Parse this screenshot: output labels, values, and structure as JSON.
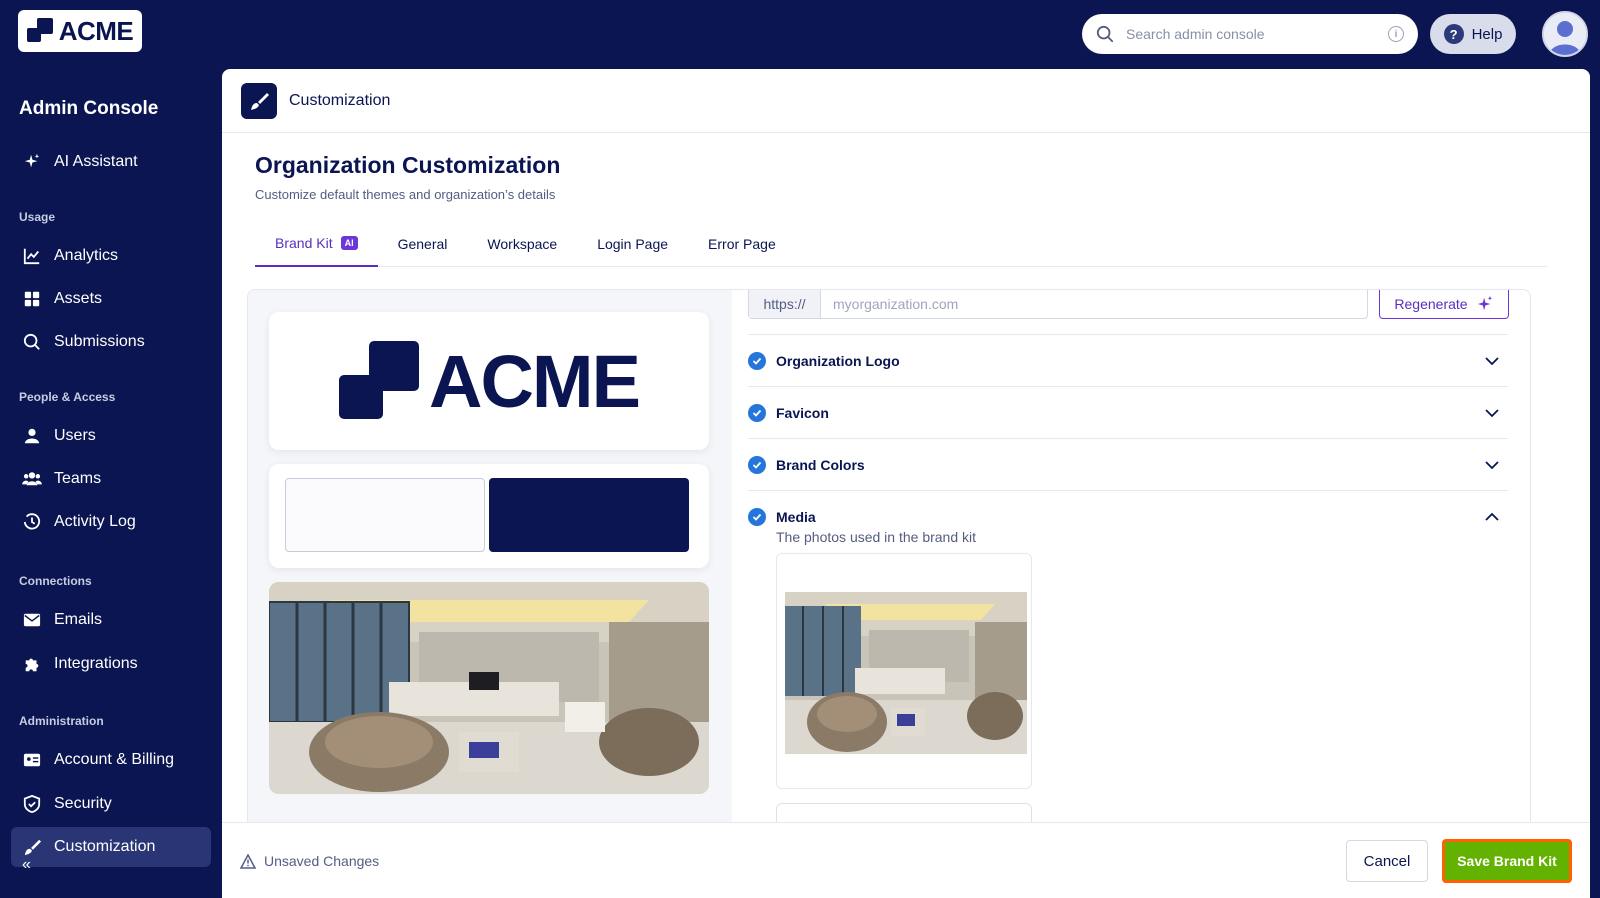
{
  "app": {
    "logo_text": "ACME",
    "search_placeholder": "Search admin console",
    "help_label": "Help"
  },
  "sidebar": {
    "title": "Admin Console",
    "ai_assistant": "AI Assistant",
    "sections": {
      "usage": "Usage",
      "people": "People & Access",
      "connections": "Connections",
      "administration": "Administration"
    },
    "items": {
      "analytics": "Analytics",
      "assets": "Assets",
      "submissions": "Submissions",
      "users": "Users",
      "teams": "Teams",
      "activity_log": "Activity Log",
      "emails": "Emails",
      "integrations": "Integrations",
      "account_billing": "Account & Billing",
      "security": "Security",
      "customization": "Customization"
    }
  },
  "header": {
    "title": "Customization"
  },
  "page": {
    "title": "Organization Customization",
    "subtitle": "Customize default themes and organization’s details"
  },
  "tabs": {
    "brand_kit": "Brand Kit",
    "ai_badge": "AI",
    "general": "General",
    "workspace": "Workspace",
    "login_page": "Login Page",
    "error_page": "Error Page"
  },
  "preview": {
    "logo_text": "ACME",
    "swatch_light": "#fbfbfd",
    "swatch_dark": "#0a1551"
  },
  "settings": {
    "url_prefix": "https://",
    "url_placeholder": "myorganization.com",
    "regenerate_label": "Regenerate",
    "accordion": {
      "logo": "Organization Logo",
      "favicon": "Favicon",
      "colors": "Brand Colors",
      "media": "Media",
      "media_sub": "The photos used in the brand kit"
    }
  },
  "footer": {
    "unsaved": "Unsaved Changes",
    "cancel": "Cancel",
    "save": "Save Brand Kit"
  },
  "colors": {
    "navy": "#0a1551",
    "purple": "#5a2ec0",
    "check_blue": "#2476db",
    "save_green": "#64b200",
    "save_outline": "#ff6100"
  }
}
